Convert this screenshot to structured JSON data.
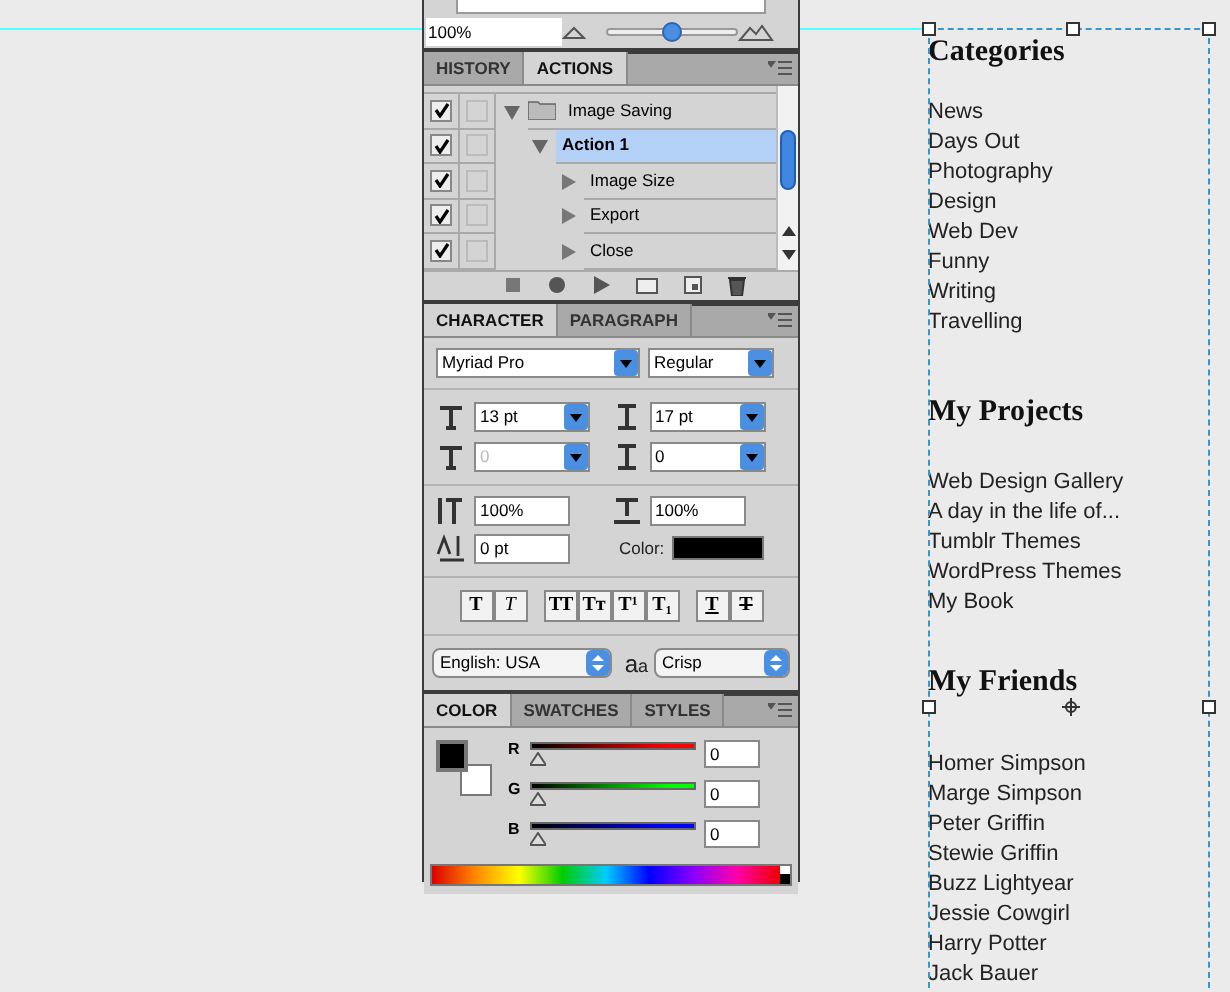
{
  "navigator": {
    "zoom": "100%",
    "level": 0.5
  },
  "actions_panel": {
    "tabs": [
      {
        "label": "HISTORY",
        "selected": false
      },
      {
        "label": "ACTIONS",
        "selected": true
      }
    ],
    "items": [
      {
        "label": "Image Saving",
        "checked": true,
        "expanded": true,
        "selected": false,
        "children": [
          {
            "label": "Action 1",
            "checked": true,
            "expanded": true,
            "selected": true,
            "children": [
              {
                "label": "Image Size",
                "checked": true,
                "expanded": false,
                "selected": false
              },
              {
                "label": "Export",
                "checked": true,
                "expanded": false,
                "selected": false
              },
              {
                "label": "Close",
                "checked": true,
                "expanded": false,
                "selected": false
              }
            ]
          }
        ]
      }
    ]
  },
  "character_panel": {
    "tabs": [
      {
        "label": "CHARACTER",
        "selected": true
      },
      {
        "label": "PARAGRAPH",
        "selected": false
      }
    ],
    "font": "Myriad Pro",
    "style": "Regular",
    "size": "13 pt",
    "leading": "17 pt",
    "kerning": {
      "value": "0",
      "disabled": true
    },
    "tracking": {
      "value": "0",
      "disabled": false
    },
    "vertical_scale": "100%",
    "horizontal_scale": "100%",
    "baseline_shift": "0 pt",
    "color_label": "Color:",
    "color": "#000000",
    "style_groups": [
      [
        {
          "kind": "bold",
          "glyph": "T"
        },
        {
          "kind": "italic",
          "glyph": "T"
        }
      ],
      [
        {
          "kind": "caps",
          "glyph": "TT"
        },
        {
          "kind": "smallcaps",
          "glyph": "Tт"
        },
        {
          "kind": "super",
          "glyph": "T¹"
        },
        {
          "kind": "sub",
          "glyph": "T₁"
        }
      ],
      [
        {
          "kind": "underline",
          "glyph": "T"
        },
        {
          "kind": "strike",
          "glyph": "T"
        }
      ]
    ],
    "language": "English: USA",
    "antialias_glyph": "aa",
    "antialias": "Crisp"
  },
  "color_panel": {
    "tabs": [
      {
        "label": "COLOR",
        "selected": true
      },
      {
        "label": "SWATCHES",
        "selected": false
      },
      {
        "label": "STYLES",
        "selected": false
      }
    ],
    "foreground": {
      "color": "#000000"
    },
    "background": {
      "color": "#ffffff"
    },
    "channels": [
      {
        "label": "R",
        "color": "#ff0000",
        "level": 0,
        "value": "0"
      },
      {
        "label": "G",
        "color": "#00ff00",
        "level": 0,
        "value": "0"
      },
      {
        "label": "B",
        "color": "#0000ff",
        "level": 0,
        "value": "0"
      }
    ]
  },
  "sidebar": {
    "sections": [
      {
        "title": "Categories",
        "items": [
          "News",
          "Days Out",
          "Photography",
          "Design",
          "Web Dev",
          "Funny",
          "Writing",
          "Travelling"
        ]
      },
      {
        "title": "My Projects",
        "items": [
          "Web Design Gallery",
          "A day in the life of...",
          "Tumblr Themes",
          "WordPress Themes",
          "My Book"
        ]
      },
      {
        "title": "My Friends",
        "items": [
          "Homer Simpson",
          "Marge Simpson",
          "Peter Griffin",
          "Stewie Griffin",
          "Buzz Lightyear",
          "Jessie Cowgirl",
          "Harry Potter",
          "Jack Bauer"
        ]
      }
    ]
  }
}
